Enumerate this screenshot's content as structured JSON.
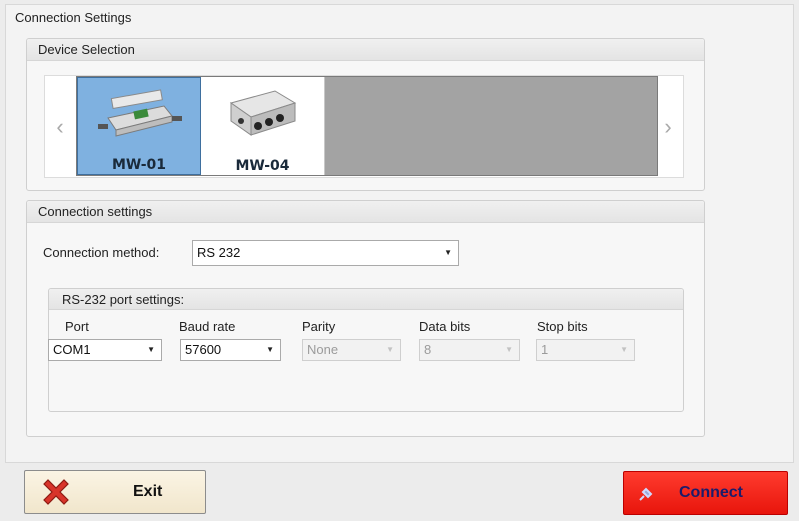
{
  "window": {
    "title": "Connection Settings"
  },
  "device_selection": {
    "title": "Device Selection",
    "prev_icon": "chevron-left-icon",
    "next_icon": "chevron-right-icon",
    "devices": [
      {
        "label": "MW-01",
        "selected": true
      },
      {
        "label": "MW-04",
        "selected": false
      }
    ]
  },
  "connection_settings": {
    "title": "Connection settings",
    "method_label": "Connection method:",
    "method_value": "RS 232",
    "rs232": {
      "title": "RS-232 port settings:",
      "port": {
        "label": "Port",
        "value": "COM1",
        "enabled": true
      },
      "baud": {
        "label": "Baud rate",
        "value": "57600",
        "enabled": true
      },
      "parity": {
        "label": "Parity",
        "value": "None",
        "enabled": false
      },
      "data_bits": {
        "label": "Data bits",
        "value": "8",
        "enabled": false
      },
      "stop_bits": {
        "label": "Stop bits",
        "value": "1",
        "enabled": false
      }
    }
  },
  "footer": {
    "exit_label": "Exit",
    "connect_label": "Connect"
  },
  "colors": {
    "selected_tile": "#7fb1e0",
    "connect_button": "#e8150c",
    "exit_icon": "#d8342a"
  }
}
